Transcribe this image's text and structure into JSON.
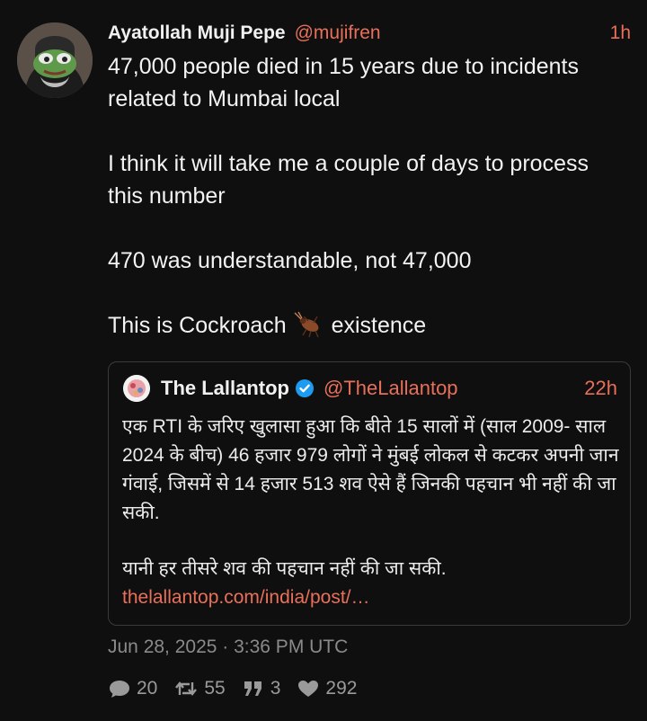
{
  "tweet": {
    "display_name": "Ayatollah Muji Pepe",
    "handle": "@mujifren",
    "time": "1h",
    "paragraphs": [
      "47,000 people died in 15 years due to incidents related to Mumbai local",
      "I think it will take me a couple of days to process this number",
      "470 was understandable, not 47,000"
    ],
    "last_line_before": "This is Cockroach",
    "last_line_after": "existence",
    "emoji_icon": "cockroach-icon",
    "date": "Jun 28, 2025 · 3:36 PM UTC",
    "stats": {
      "replies": "20",
      "retweets": "55",
      "quotes": "3",
      "likes": "292"
    }
  },
  "quote": {
    "display_name": "The Lallantop",
    "handle": "@TheLallantop",
    "time": "22h",
    "verified_icon": "verified-badge-icon",
    "paragraph1": "एक RTI के जरिए खुलासा हुआ कि बीते 15 सालों में (साल 2009- साल 2024 के बीच) 46 हजार 979 लोगों ने मुंबई लोकल से कटकर अपनी जान गंवाई, जिसमें से 14 हजार 513 शव ऐसे हैं जिनकी पहचान भी नहीं की जा सकी.",
    "paragraph2": "यानी हर तीसरे शव की पहचान नहीं की जा सकी.",
    "link": "thelallantop.com/india/post/…"
  },
  "colors": {
    "background": "#0f0f0f",
    "accent": "#e8705a",
    "muted": "#8a8a8a",
    "border": "#3a3a3a"
  }
}
